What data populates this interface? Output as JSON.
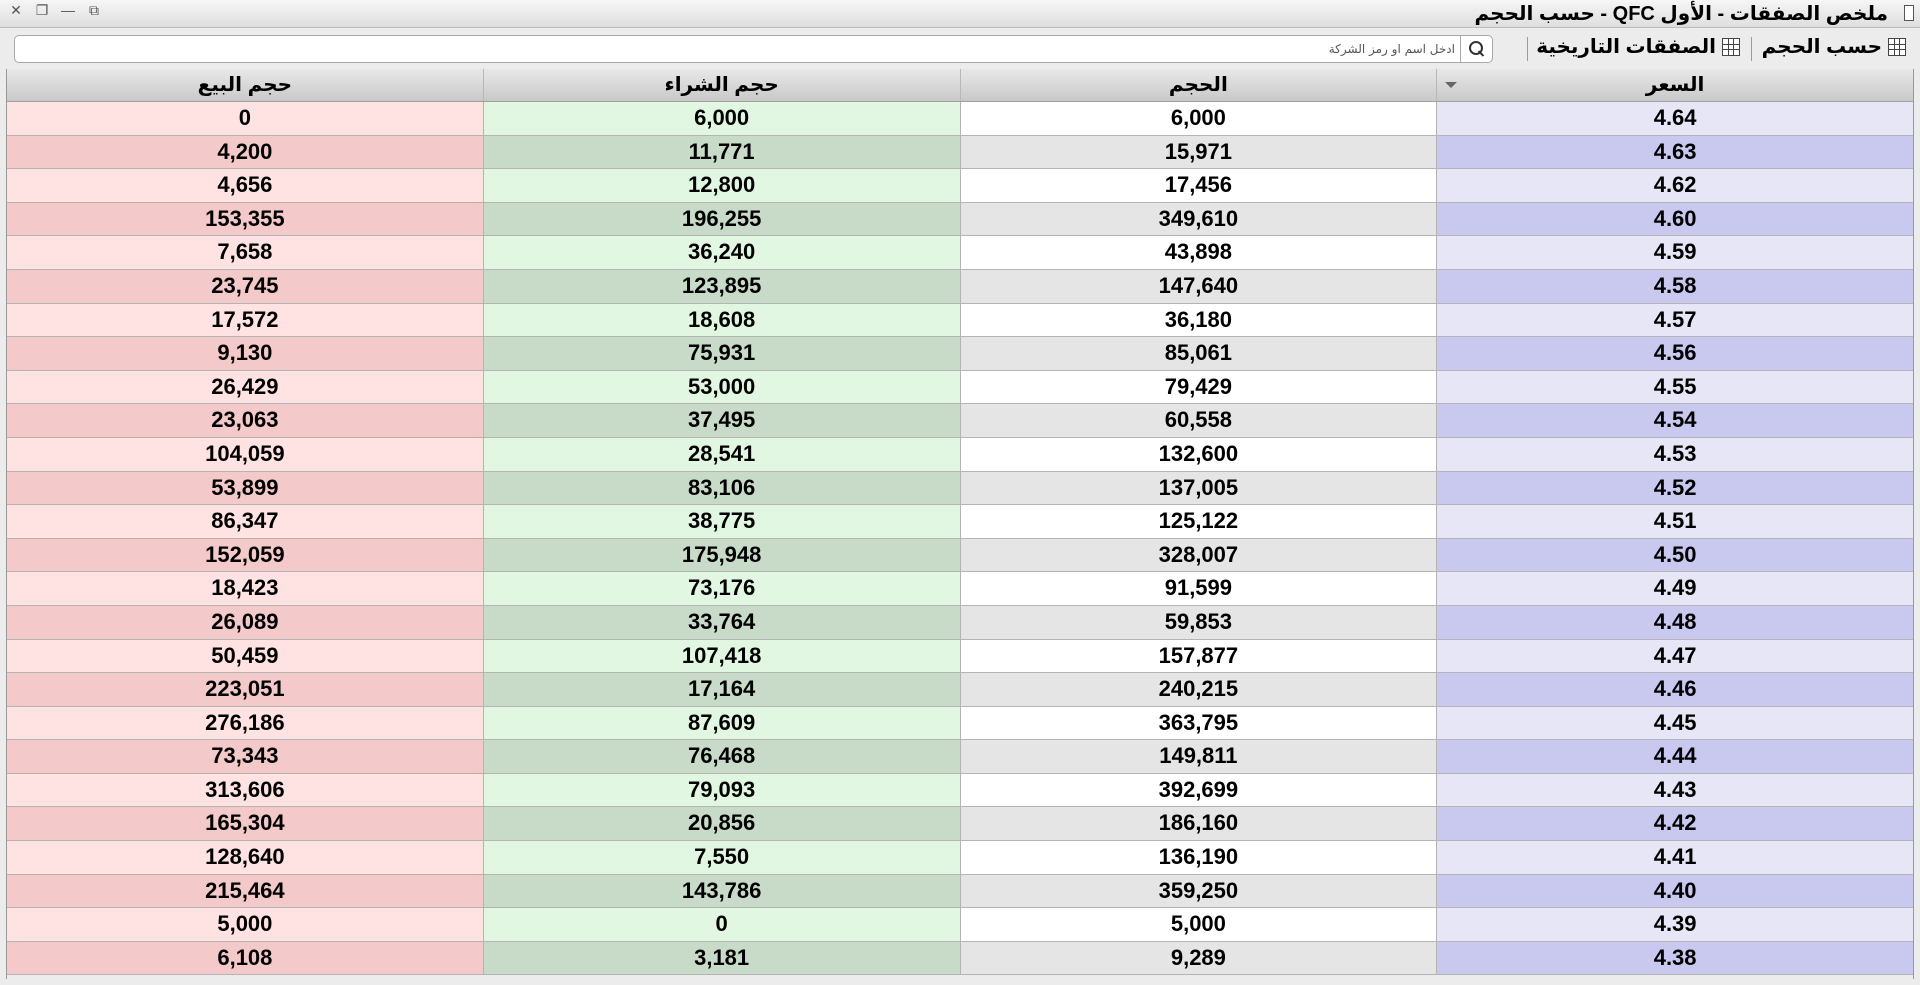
{
  "window": {
    "title": "ملخص الصفقات - الأول QFC - حسب الحجم",
    "close_glyph": "✕",
    "restore_glyph": "❐",
    "minimize_glyph": "—",
    "popout_glyph": "⧉"
  },
  "toolbar": {
    "by_volume_label": "حسب الحجم",
    "historical_trades_label": "الصفقات التاريخية",
    "search_placeholder": "ادخل اسم او رمز الشركة"
  },
  "table": {
    "headers": {
      "price": "السعر",
      "volume": "الحجم",
      "buy_volume": "حجم الشراء",
      "sell_volume": "حجم البيع"
    },
    "rows": [
      {
        "price": "4.64",
        "volume": "6,000",
        "buy": "6,000",
        "sell": "0"
      },
      {
        "price": "4.63",
        "volume": "15,971",
        "buy": "11,771",
        "sell": "4,200"
      },
      {
        "price": "4.62",
        "volume": "17,456",
        "buy": "12,800",
        "sell": "4,656"
      },
      {
        "price": "4.60",
        "volume": "349,610",
        "buy": "196,255",
        "sell": "153,355"
      },
      {
        "price": "4.59",
        "volume": "43,898",
        "buy": "36,240",
        "sell": "7,658"
      },
      {
        "price": "4.58",
        "volume": "147,640",
        "buy": "123,895",
        "sell": "23,745"
      },
      {
        "price": "4.57",
        "volume": "36,180",
        "buy": "18,608",
        "sell": "17,572"
      },
      {
        "price": "4.56",
        "volume": "85,061",
        "buy": "75,931",
        "sell": "9,130"
      },
      {
        "price": "4.55",
        "volume": "79,429",
        "buy": "53,000",
        "sell": "26,429"
      },
      {
        "price": "4.54",
        "volume": "60,558",
        "buy": "37,495",
        "sell": "23,063"
      },
      {
        "price": "4.53",
        "volume": "132,600",
        "buy": "28,541",
        "sell": "104,059"
      },
      {
        "price": "4.52",
        "volume": "137,005",
        "buy": "83,106",
        "sell": "53,899"
      },
      {
        "price": "4.51",
        "volume": "125,122",
        "buy": "38,775",
        "sell": "86,347"
      },
      {
        "price": "4.50",
        "volume": "328,007",
        "buy": "175,948",
        "sell": "152,059"
      },
      {
        "price": "4.49",
        "volume": "91,599",
        "buy": "73,176",
        "sell": "18,423"
      },
      {
        "price": "4.48",
        "volume": "59,853",
        "buy": "33,764",
        "sell": "26,089"
      },
      {
        "price": "4.47",
        "volume": "157,877",
        "buy": "107,418",
        "sell": "50,459"
      },
      {
        "price": "4.46",
        "volume": "240,215",
        "buy": "17,164",
        "sell": "223,051"
      },
      {
        "price": "4.45",
        "volume": "363,795",
        "buy": "87,609",
        "sell": "276,186"
      },
      {
        "price": "4.44",
        "volume": "149,811",
        "buy": "76,468",
        "sell": "73,343"
      },
      {
        "price": "4.43",
        "volume": "392,699",
        "buy": "79,093",
        "sell": "313,606"
      },
      {
        "price": "4.42",
        "volume": "186,160",
        "buy": "20,856",
        "sell": "165,304"
      },
      {
        "price": "4.41",
        "volume": "136,190",
        "buy": "7,550",
        "sell": "128,640"
      },
      {
        "price": "4.40",
        "volume": "359,250",
        "buy": "143,786",
        "sell": "215,464"
      },
      {
        "price": "4.39",
        "volume": "5,000",
        "buy": "0",
        "sell": "5,000"
      },
      {
        "price": "4.38",
        "volume": "9,289",
        "buy": "3,181",
        "sell": "6,108"
      }
    ]
  },
  "colors": {
    "price_light": "#e6e6f6",
    "price_dark": "#c9c9f0",
    "buy_light": "#e1f7e1",
    "buy_dark": "#c8dbc8",
    "sell_light": "#ffe3e3",
    "sell_dark": "#f3c9c9"
  }
}
